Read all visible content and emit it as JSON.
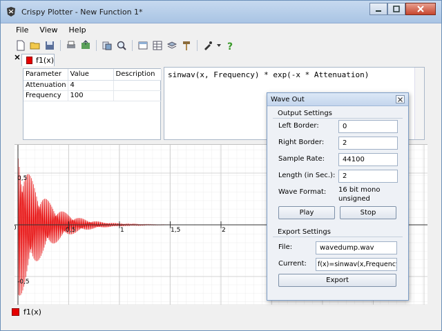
{
  "window": {
    "title": "Crispy Plotter - New Function 1*"
  },
  "menu": [
    "File",
    "View",
    "Help"
  ],
  "tab": {
    "label": "f1(x)",
    "color": "#e60000"
  },
  "params": {
    "headers": [
      "Parameter",
      "Value",
      "Description"
    ],
    "rows": [
      [
        "Attenuation",
        "4",
        ""
      ],
      [
        "Frequency",
        "100",
        ""
      ]
    ]
  },
  "expression": "sinwav(x, Frequency) * exp(-x * Attenuation)",
  "plot": {
    "x_tick_labels": [
      "0,5",
      "1",
      "1,5",
      "2"
    ],
    "y_tick_labels": [
      "0,5",
      "-0,5"
    ],
    "origin_label": "0",
    "curve_color": "#e60000"
  },
  "status": {
    "label": "f1(x)"
  },
  "dialog": {
    "title": "Wave Out",
    "output_group": "Output Settings",
    "left_border_label": "Left Border:",
    "left_border_value": "0",
    "right_border_label": "Right Border:",
    "right_border_value": "2",
    "sample_rate_label": "Sample Rate:",
    "sample_rate_value": "44100",
    "length_label": "Length (in Sec.):",
    "length_value": "2",
    "wave_format_label": "Wave Format:",
    "wave_format_value": "16 bit mono unsigned",
    "play_label": "Play",
    "stop_label": "Stop",
    "export_group": "Export Settings",
    "file_label": "File:",
    "file_value": "wavedump.wav",
    "current_label": "Current:",
    "current_value": "f(x)=sinwav(x,Frequency)*e",
    "export_label": "Export"
  }
}
